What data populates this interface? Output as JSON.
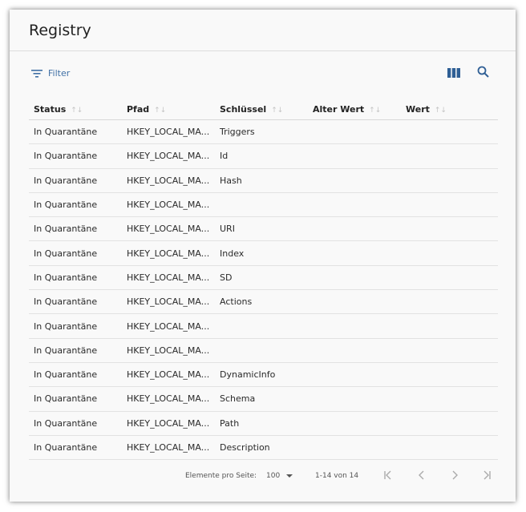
{
  "title": "Registry",
  "toolbar": {
    "filter_label": "Filter"
  },
  "columns": [
    {
      "label": "Status"
    },
    {
      "label": "Pfad"
    },
    {
      "label": "Schlüssel"
    },
    {
      "label": "Alter Wert"
    },
    {
      "label": "Wert"
    }
  ],
  "rows": [
    [
      "In Quarantäne",
      "HKEY_LOCAL_MA...",
      "Triggers",
      "",
      ""
    ],
    [
      "In Quarantäne",
      "HKEY_LOCAL_MA...",
      "Id",
      "",
      ""
    ],
    [
      "In Quarantäne",
      "HKEY_LOCAL_MA...",
      "Hash",
      "",
      ""
    ],
    [
      "In Quarantäne",
      "HKEY_LOCAL_MA...",
      "",
      "",
      ""
    ],
    [
      "In Quarantäne",
      "HKEY_LOCAL_MA...",
      "URI",
      "",
      ""
    ],
    [
      "In Quarantäne",
      "HKEY_LOCAL_MA...",
      "Index",
      "",
      ""
    ],
    [
      "In Quarantäne",
      "HKEY_LOCAL_MA...",
      "SD",
      "",
      ""
    ],
    [
      "In Quarantäne",
      "HKEY_LOCAL_MA...",
      "Actions",
      "",
      ""
    ],
    [
      "In Quarantäne",
      "HKEY_LOCAL_MA...",
      "",
      "",
      ""
    ],
    [
      "In Quarantäne",
      "HKEY_LOCAL_MA...",
      "",
      "",
      ""
    ],
    [
      "In Quarantäne",
      "HKEY_LOCAL_MA...",
      "DynamicInfo",
      "",
      ""
    ],
    [
      "In Quarantäne",
      "HKEY_LOCAL_MA...",
      "Schema",
      "",
      ""
    ],
    [
      "In Quarantäne",
      "HKEY_LOCAL_MA...",
      "Path",
      "",
      ""
    ],
    [
      "In Quarantäne",
      "HKEY_LOCAL_MA...",
      "Description",
      "",
      ""
    ]
  ],
  "paginator": {
    "per_page_label": "Elemente pro Seite:",
    "per_page_value": "100",
    "range": "1-14 von 14"
  },
  "colors": {
    "accent": "#3f6fa5",
    "icon_blue": "#2f5f95"
  },
  "icons": [
    "filter-icon",
    "columns-icon",
    "search-icon",
    "first-page-icon",
    "prev-page-icon",
    "next-page-icon",
    "last-page-icon",
    "sort-icon"
  ]
}
